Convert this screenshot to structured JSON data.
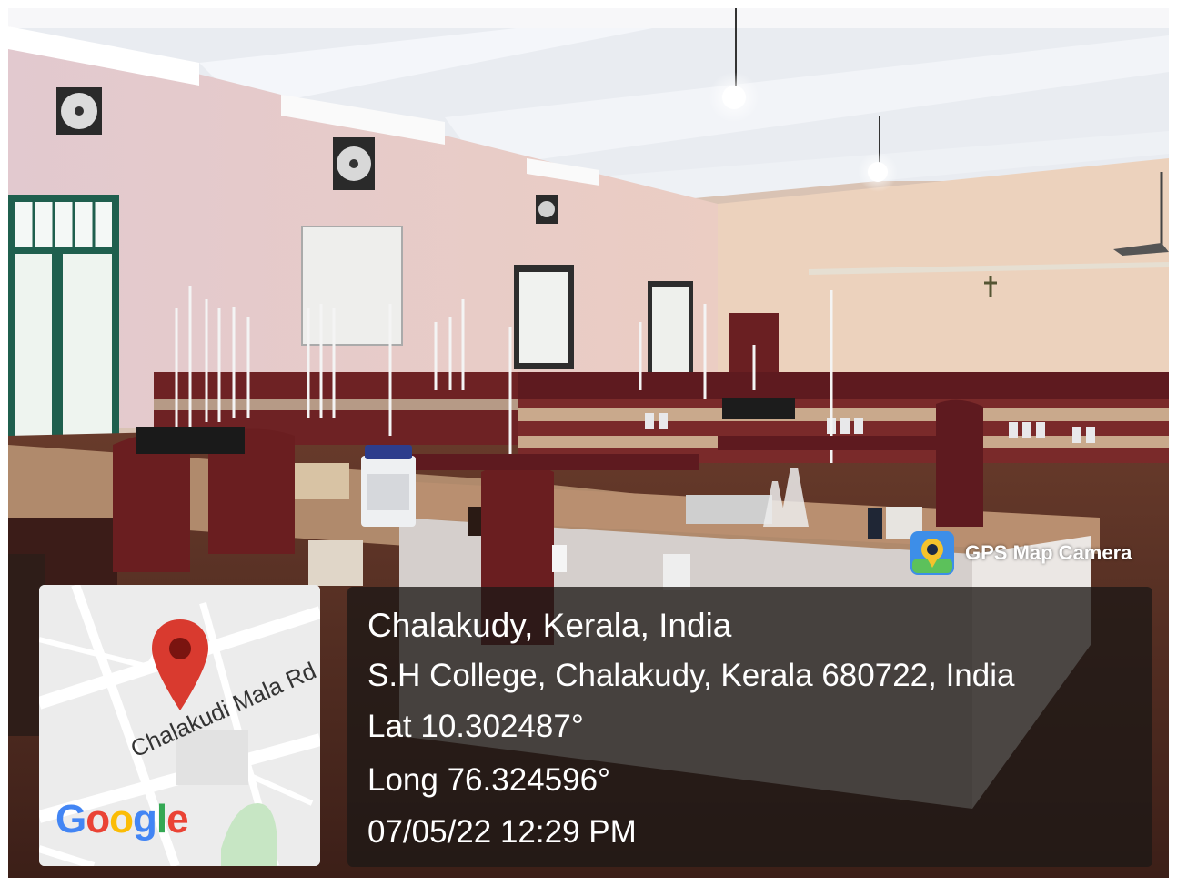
{
  "badge": {
    "label": "GPS Map Camera",
    "icon": "gps-camera-icon"
  },
  "location": {
    "title": "Chalakudy, Kerala, India",
    "address": "S.H College, Chalakudy, Kerala 680722, India",
    "lat": "Lat 10.302487°",
    "long": "Long 76.324596°",
    "datetime": "07/05/22 12:29 PM"
  },
  "map": {
    "road_label": "Chalakudi Mala Rd",
    "logo": "Google",
    "pin_icon": "map-pin-icon",
    "pin_color": "#d93a2f"
  },
  "colors": {
    "google_blue": "#4285f4",
    "google_red": "#ea4335",
    "google_yellow": "#fbbc05",
    "google_green": "#34a853"
  }
}
